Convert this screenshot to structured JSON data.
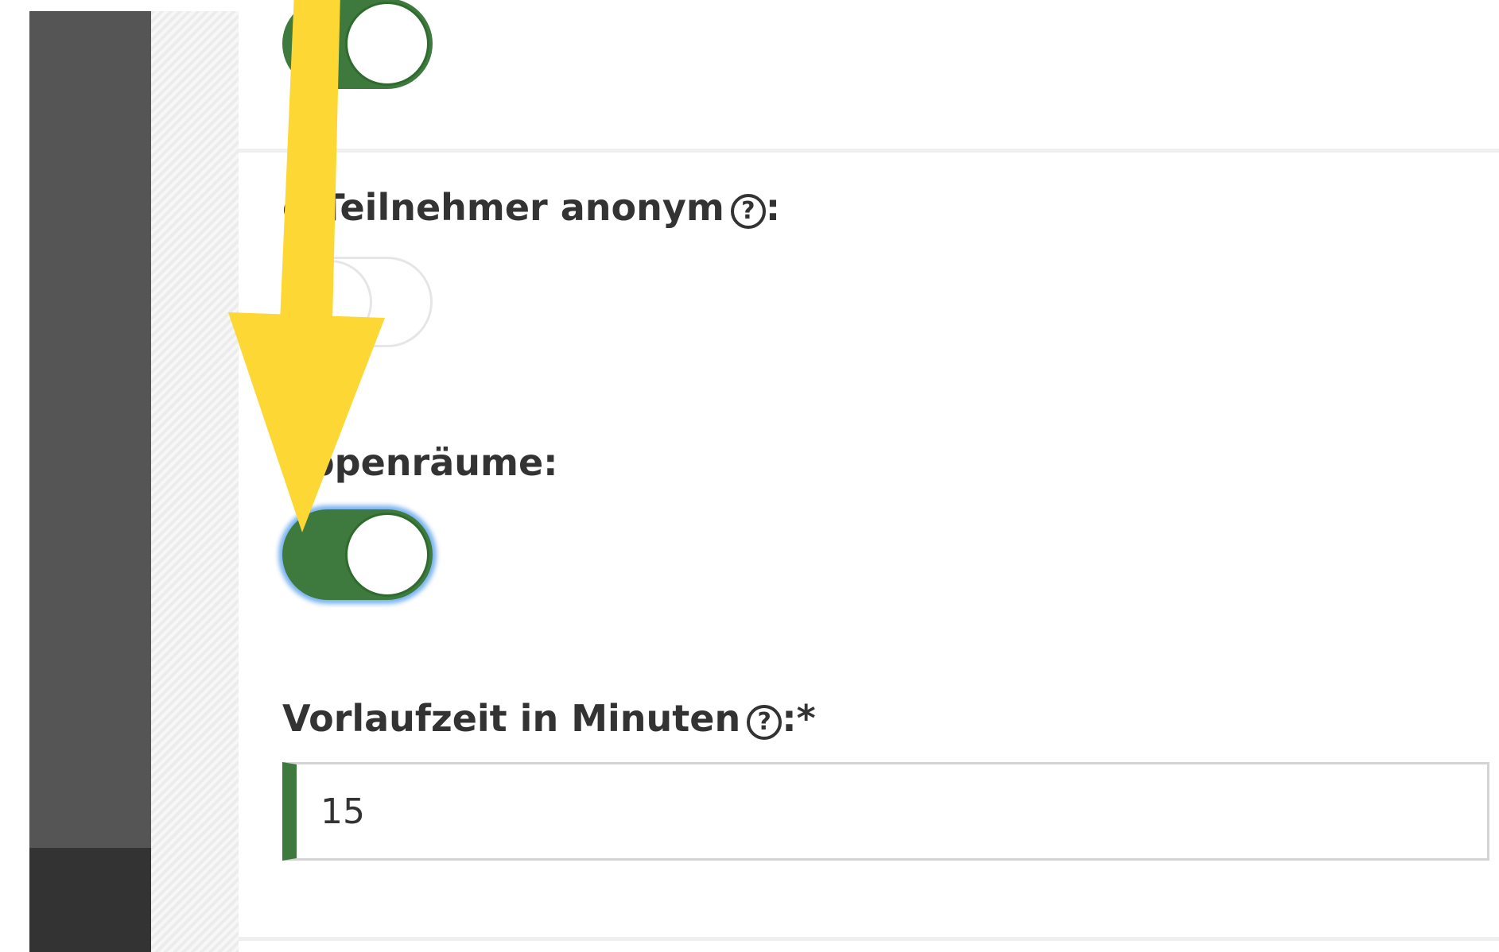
{
  "toggles": {
    "top_toggle": {
      "state": "on"
    },
    "anonymous_toggle": {
      "state": "off"
    },
    "breakout_toggle": {
      "state": "on",
      "focused": true
    }
  },
  "labels": {
    "anonymous": "e Teilnehmer anonym",
    "anonymous_suffix": ":",
    "breakout": "uppenräume:",
    "lead_time": "Vorlaufzeit in Minuten",
    "lead_time_suffix": ":*"
  },
  "icons": {
    "help": "?"
  },
  "lead_time_input": {
    "value": "15"
  },
  "colors": {
    "accent_green": "#3e7a3e",
    "annotation_arrow": "#FDD835",
    "sidebar": "#555555",
    "focus_glow": "#4f9beb"
  }
}
